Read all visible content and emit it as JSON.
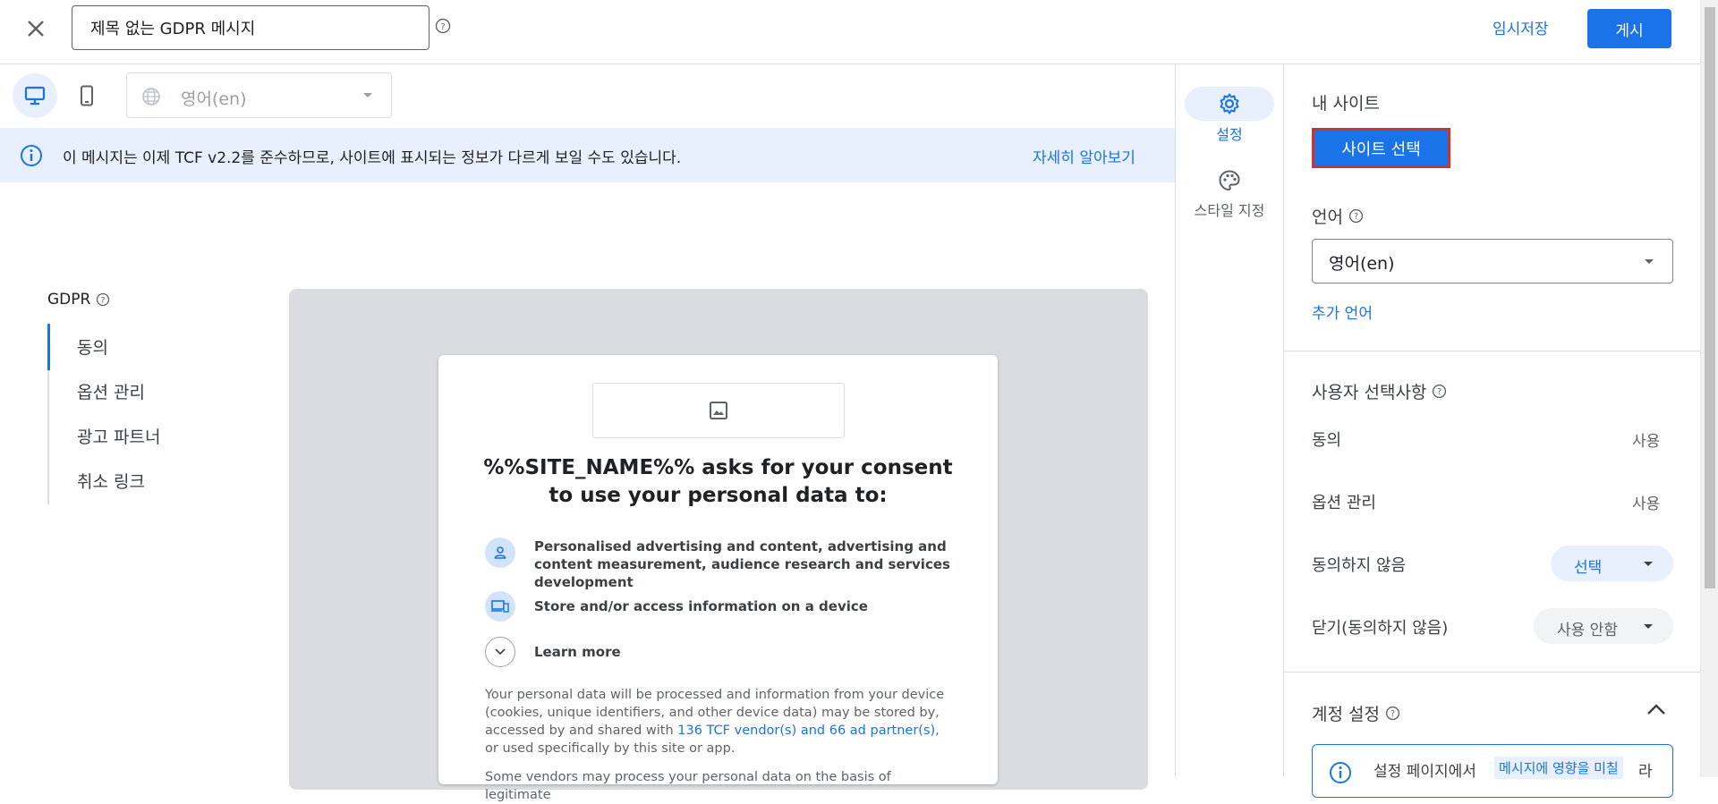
{
  "header": {
    "close_icon": "close-icon",
    "title_value": "제목 없는 GDPR 메시지",
    "save_draft": "임시저장",
    "publish": "게시"
  },
  "preview_toolbar": {
    "language": "영어(en)"
  },
  "banner": {
    "message": "이 메시지는 이제 TCF v2.2를 준수하므로, 사이트에 표시되는 정보가 다르게 보일 수도 있습니다.",
    "learn_more": "자세히 알아보기"
  },
  "left_nav": {
    "title": "GDPR",
    "items": [
      {
        "label": "동의"
      },
      {
        "label": "옵션 관리"
      },
      {
        "label": "광고 파트너"
      },
      {
        "label": "취소 링크"
      }
    ]
  },
  "preview_card": {
    "heading": "%%SITE_NAME%% asks for your consent to use your personal data to:",
    "purposes": [
      {
        "icon": "person-icon",
        "text": "Personalised advertising and content, advertising and content measurement, audience research and services development"
      },
      {
        "icon": "devices-icon",
        "text": "Store and/or access information on a device"
      },
      {
        "icon": "chevron-down-icon",
        "text": "Learn more"
      }
    ],
    "body_prefix": "Your personal data will be processed and information from your device (cookies, unique identifiers, and other device data) may be stored by, accessed by and shared with ",
    "body_link": "136 TCF vendor(s) and 66 ad partner(s)",
    "body_suffix": ", or used specifically by this site or app.",
    "body2": "Some vendors may process your personal data on the basis of legitimate"
  },
  "side_tabs": {
    "settings": "설정",
    "style": "스타일 지정"
  },
  "settings_panel": {
    "my_site_label": "내 사이트",
    "select_site_button": "사이트 선택",
    "language_label": "언어",
    "language_value": "영어(en)",
    "add_language": "추가 언어",
    "user_choices_label": "사용자 선택사항",
    "choices": [
      {
        "label": "동의",
        "value": "사용"
      },
      {
        "label": "옵션 관리",
        "value": "사용"
      },
      {
        "label": "동의하지 않음",
        "value": "선택"
      },
      {
        "label": "닫기(동의하지 않음)",
        "value": "사용 안함"
      }
    ],
    "account_settings_label": "계정 설정",
    "notice_prefix": "설정 페이지에서",
    "notice_chip": "메시지에 영향을 미칠",
    "notice_suffix": "라"
  },
  "colors": {
    "accent": "#1a73e8",
    "banner_bg": "#e8f0fe",
    "highlight_border": "#d93025"
  }
}
